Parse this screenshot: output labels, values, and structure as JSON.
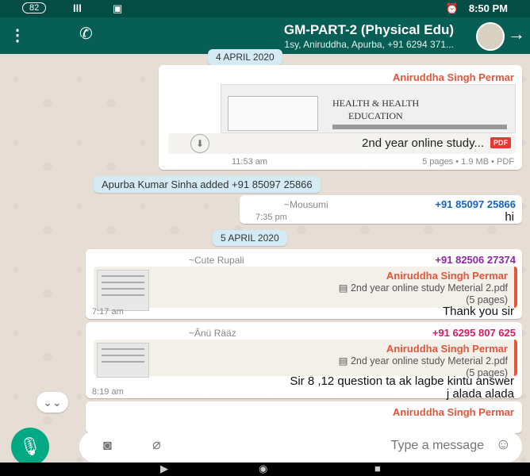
{
  "status": {
    "time": "8:50 PM",
    "battery": "82",
    "network": "lll"
  },
  "header": {
    "title": "GM-PART-2 (Physical Edu)",
    "subtitle": "1sy, Aniruddha, Apurba, +91 6294 371...",
    "colors": {
      "bar": "#075e54",
      "accent": "#00a884"
    }
  },
  "dates": {
    "first": "4 APRIL 2020",
    "second": "5 APRIL 2020"
  },
  "messages": {
    "pdf": {
      "sender": "Aniruddha Singh Permar",
      "file_name": "2nd year online study...",
      "file_badge": "PDF",
      "file_info": "5 pages • 1.9 MB • PDF",
      "time": "11:53 am",
      "preview_lines": [
        "HEALTH & HEALTH",
        "EDUCATION"
      ]
    },
    "system": "Apurba Kumar Sinha added +91 85097 25866",
    "hi": {
      "sender": "+91 85097 25866",
      "alias": "~Mousumi",
      "text": "hi",
      "time": "7:35 pm"
    },
    "thank": {
      "sender": "+91 82506 27374",
      "alias": "~Cute Rupali",
      "reply_sender": "Aniruddha Singh Permar",
      "reply_text_1": "2nd year online study Meterial 2.pdf",
      "reply_text_2": "(5 pages)",
      "text": "Thank you sir",
      "time": "7:17 am"
    },
    "sir": {
      "sender": "+91 6295 807 625",
      "alias": "~Ânü Rääz",
      "reply_sender": "Aniruddha Singh Permar",
      "reply_text_1": "2nd year online study Meterial 2.pdf",
      "reply_text_2": "(5 pages)",
      "text_1": "Sir 8 ,12 question ta ak lagbe kintu answer",
      "text_2": "j alada alada",
      "time": "8:19 am"
    },
    "last": {
      "sender": "Aniruddha Singh Permar"
    }
  },
  "input": {
    "placeholder": "Type a message"
  }
}
